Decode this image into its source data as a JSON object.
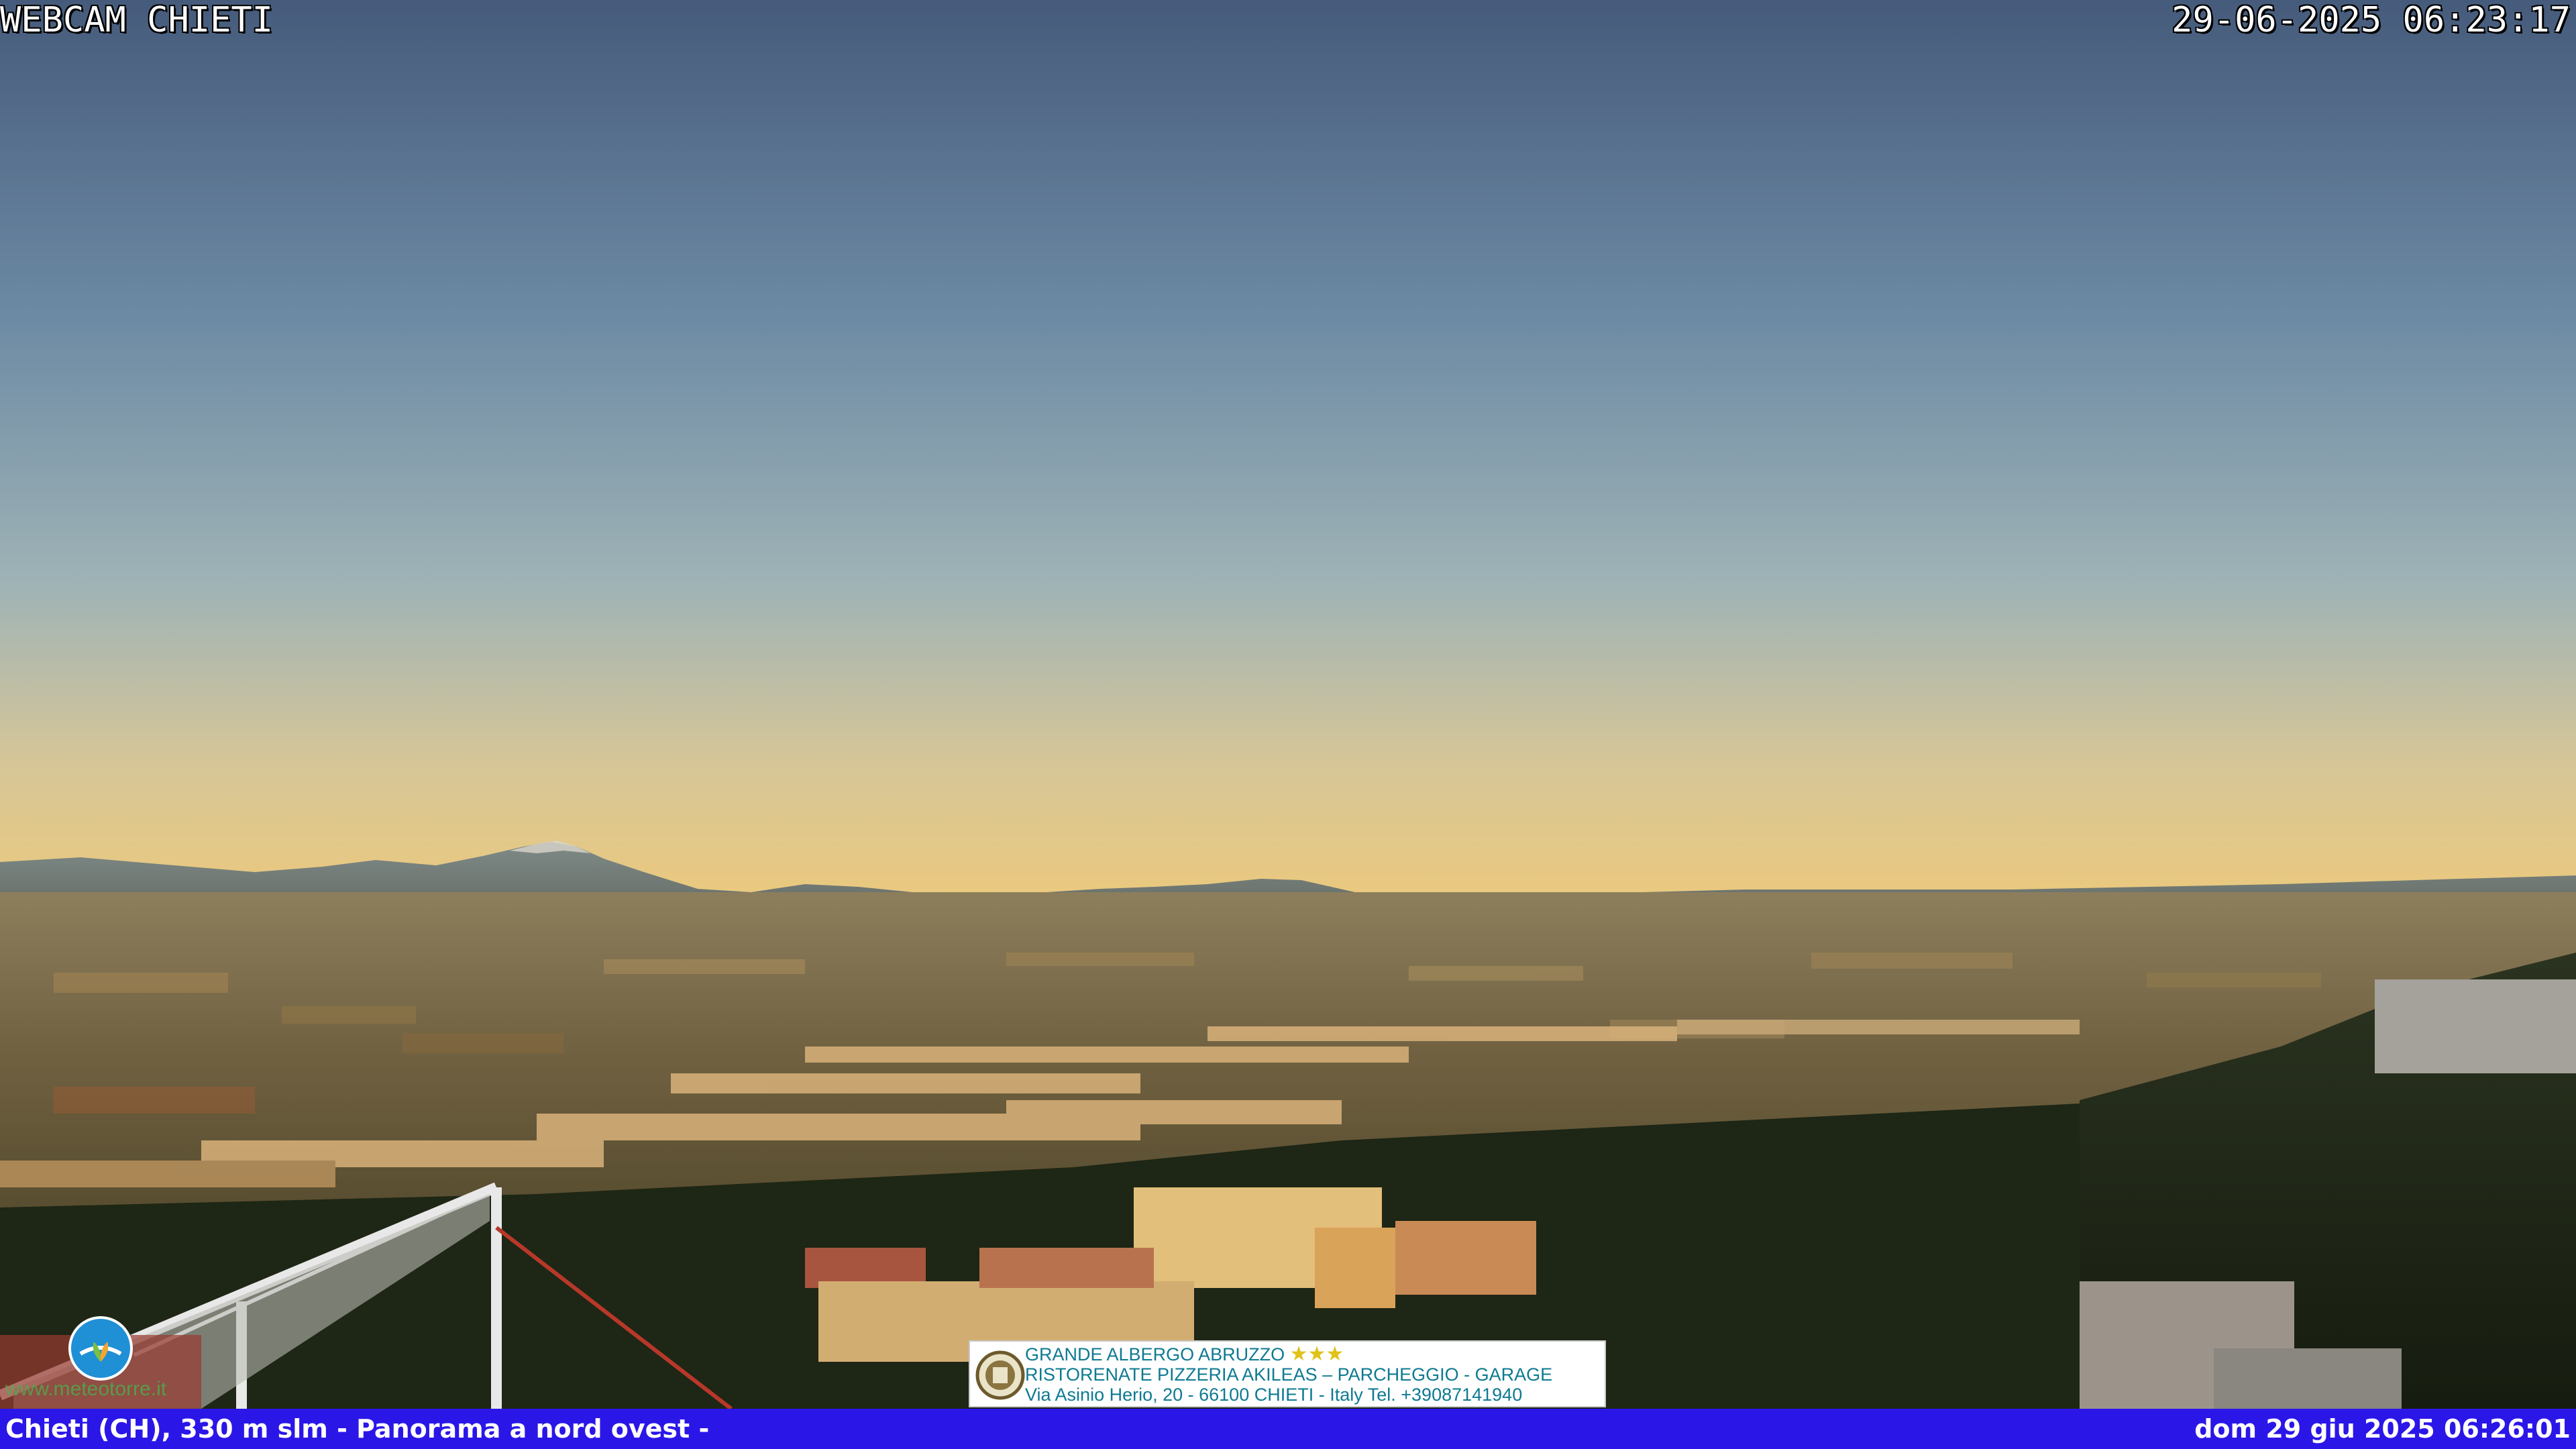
{
  "overlay": {
    "title": "WEBCAM CHIETI",
    "timestamp": "29-06-2025 06:23:17"
  },
  "bottom_bar": {
    "location_text": "Chieti (CH), 330 m slm - Panorama a nord ovest -",
    "datetime_text": "dom 29 giu 2025 06:26:01",
    "background_color": "#2b16e8"
  },
  "ad_banner": {
    "line1": "GRANDE ALBERGO ABRUZZO",
    "stars": 3,
    "line2": "RISTORENATE PIZZERIA AKILEAS – PARCHEGGIO - GARAGE",
    "line3": "Via Asinio Herio, 20 - 66100 CHIETI - Italy Tel. +39087141940",
    "text_color": "#0e7a91"
  },
  "watermark": {
    "icon": "meteo-logo-icon",
    "text": "www.meteotorre.it"
  },
  "colors": {
    "sky_top": "#4a6180",
    "sky_mid": "#7e9bb0",
    "horizon": "#e8c985",
    "mountains": "#6d7470",
    "city_light": "#c9a35a",
    "vegetation": "#1f2a16"
  }
}
